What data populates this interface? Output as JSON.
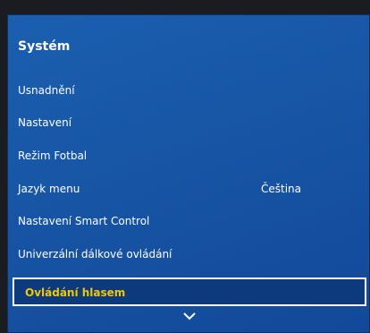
{
  "panel": {
    "title": "Systém",
    "items": [
      {
        "label": "Usnadnění",
        "value": ""
      },
      {
        "label": "Nastavení",
        "value": ""
      },
      {
        "label": "Režim Fotbal",
        "value": ""
      },
      {
        "label": "Jazyk menu",
        "value": "Čeština"
      },
      {
        "label": "Nastavení Smart Control",
        "value": ""
      },
      {
        "label": "Univerzální dálkové ovládání",
        "value": ""
      }
    ],
    "selected_item": "Ovládání hlasem",
    "scroll_icon": "chevron-down-icon"
  },
  "colors": {
    "panel_blue": "#1856a6",
    "highlight_text": "#f2c900",
    "text": "#ffffff"
  }
}
